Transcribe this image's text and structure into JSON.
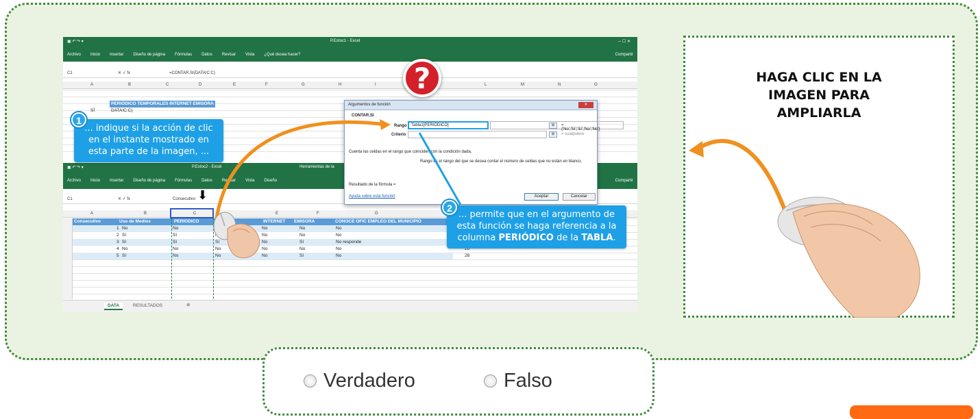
{
  "excel_top": {
    "window_title": "P.Estoc1 - Excel",
    "menu": [
      "Archivo",
      "Inicio",
      "Insertar",
      "Diseño de página",
      "Fórmulas",
      "Datos",
      "Revisar",
      "Vista",
      "¿Qué desea hacer?"
    ],
    "share": "Compartir",
    "namebox": "C1",
    "formula": "=CONTAR.SI(DATA!C:C)",
    "columns": [
      "A",
      "B",
      "C",
      "D",
      "E",
      "F",
      "G",
      "H",
      "I",
      "J",
      "K",
      "L",
      "M",
      "N",
      "O"
    ],
    "header_row": "PERIÓDICO TEMPORALES INTERNET EMISORA",
    "cell_si": "SÍ",
    "cell_data": "DATA!C:C)"
  },
  "excel_bottom": {
    "window_title": "P.Estoc2 - Excel",
    "tools_title": "Herramientas de la",
    "menu": [
      "Archivo",
      "Inicio",
      "Insertar",
      "Diseño de página",
      "Fórmulas",
      "Datos",
      "Revisar",
      "Vista",
      "Diseño"
    ],
    "share": "Compartir",
    "namebox": "C1",
    "formula_partial": "Consecutivo",
    "columns": [
      "A",
      "B",
      "C",
      "D",
      "E",
      "F",
      "G"
    ],
    "table_headers": [
      "Consecutivo",
      "Uso de Medios",
      "PERIODICO",
      "",
      "INTERNET",
      "EMISORA",
      "CONOCE OFIC EMPLEO DEL MUNICIPIO"
    ],
    "rows": [
      {
        "n": "1",
        "a": "1",
        "b": "No",
        "c": "No",
        "d": "",
        "e": "No",
        "f": "No",
        "g": "No"
      },
      {
        "n": "2",
        "a": "2",
        "b": "Sí",
        "c": "Sí",
        "d": "No",
        "e": "No",
        "f": "No",
        "g": "No"
      },
      {
        "n": "3",
        "a": "3",
        "b": "Sí",
        "c": "Sí",
        "d": "Sí",
        "e": "No",
        "f": "Sí",
        "g": "No responde"
      },
      {
        "n": "4",
        "a": "4",
        "b": "No",
        "c": "No",
        "d": "No",
        "e": "No",
        "f": "No",
        "g": "No"
      },
      {
        "n": "5",
        "a": "5",
        "b": "Sí",
        "c": "No",
        "d": "No",
        "e": "No",
        "f": "Sí",
        "g": "No"
      }
    ],
    "extra_vals": [
      "26",
      "28"
    ],
    "sheet_tabs": [
      "DATA",
      "RESULTADOS"
    ]
  },
  "dialog": {
    "title": "Argumentos de función",
    "fn_name": "CONTAR.SI",
    "range_label": "Rango",
    "range_value": "Tabla1[PERIÓDICO]",
    "range_result": "= {'No';'Sí';'Sí';'No';'No'}",
    "criteria_label": "Criterio",
    "criteria_result": "= cualquiera",
    "description": "Cuenta las celdas en el rango que coinciden con la condición dada.",
    "param_desc": "Rango  es el rango del que se desea contar el número de celdas que no están en blanco.",
    "result_label": "Resultado de la fórmula =",
    "help_link": "Ayuda sobre esta función",
    "ok": "Aceptar",
    "cancel": "Cancelar"
  },
  "callouts": {
    "one_num": "1",
    "one_text": "... indique si la acción de clic en el instante mostrado en esta parte de la imagen, ...",
    "two_num": "2",
    "two_text_a": "... permite que en el argumento de esta función se haga referencia a la columna ",
    "two_bold_1": "PERIÓDICO",
    "two_text_b": " de la ",
    "two_bold_2": "TABLA",
    "two_text_c": "."
  },
  "question_mark": "?",
  "side_card": {
    "line1": "HAGA CLIC EN LA",
    "line2": "IMAGEN PARA",
    "line3": "AMPLIARLA"
  },
  "answers": {
    "true_label": "Verdadero",
    "false_label": "Falso"
  },
  "colors": {
    "panel_bg": "#eaf3e1",
    "border": "#3e8a3a",
    "excel_green": "#217346",
    "callout_blue": "#1ea0e6",
    "arrow_orange": "#f0901e",
    "qmark_red": "#d3202a",
    "button_orange": "#ff6a13"
  }
}
